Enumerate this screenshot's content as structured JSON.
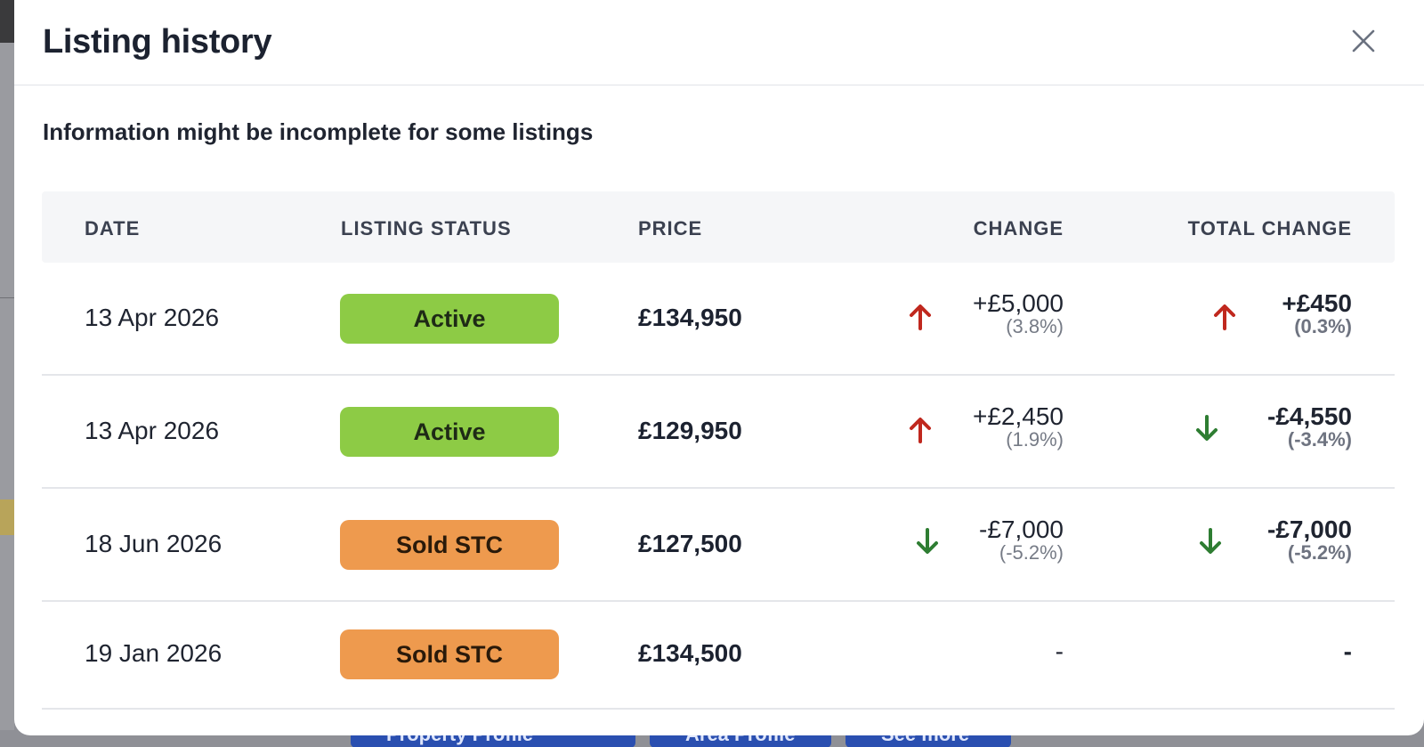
{
  "modal": {
    "title": "Listing history",
    "notice": "Information might be incomplete for some listings"
  },
  "table": {
    "headers": {
      "date": "DATE",
      "status": "LISTING STATUS",
      "price": "PRICE",
      "change": "CHANGE",
      "total_change": "TOTAL CHANGE"
    },
    "rows": [
      {
        "date": "13 Apr 2026",
        "status": "Active",
        "price": "£134,950",
        "change": "+£5,000",
        "change_pct": "(3.8%)",
        "change_dir": "up",
        "total": "+£450",
        "total_pct": "(0.3%)",
        "total_dir": "up"
      },
      {
        "date": "13 Apr 2026",
        "status": "Active",
        "price": "£129,950",
        "change": "+£2,450",
        "change_pct": "(1.9%)",
        "change_dir": "up",
        "total": "-£4,550",
        "total_pct": "(-3.4%)",
        "total_dir": "down"
      },
      {
        "date": "18 Jun 2026",
        "status": "Sold STC",
        "price": "£127,500",
        "change": "-£7,000",
        "change_pct": "(-5.2%)",
        "change_dir": "down",
        "total": "-£7,000",
        "total_pct": "(-5.2%)",
        "total_dir": "down"
      },
      {
        "date": "19 Jan 2026",
        "status": "Sold STC",
        "price": "£134,500",
        "change": "-",
        "total": "-"
      }
    ]
  },
  "colors": {
    "active_badge": "#8dcb45",
    "sold_badge": "#ee9a4e",
    "arrow_up": "#c0281e",
    "arrow_down": "#2e7d32"
  },
  "icons": {
    "close": "close-icon",
    "up": "arrow-up-icon",
    "down": "arrow-down-icon"
  },
  "background": {
    "buttons": [
      "Property Profile",
      "Area Profile",
      "See more"
    ]
  }
}
